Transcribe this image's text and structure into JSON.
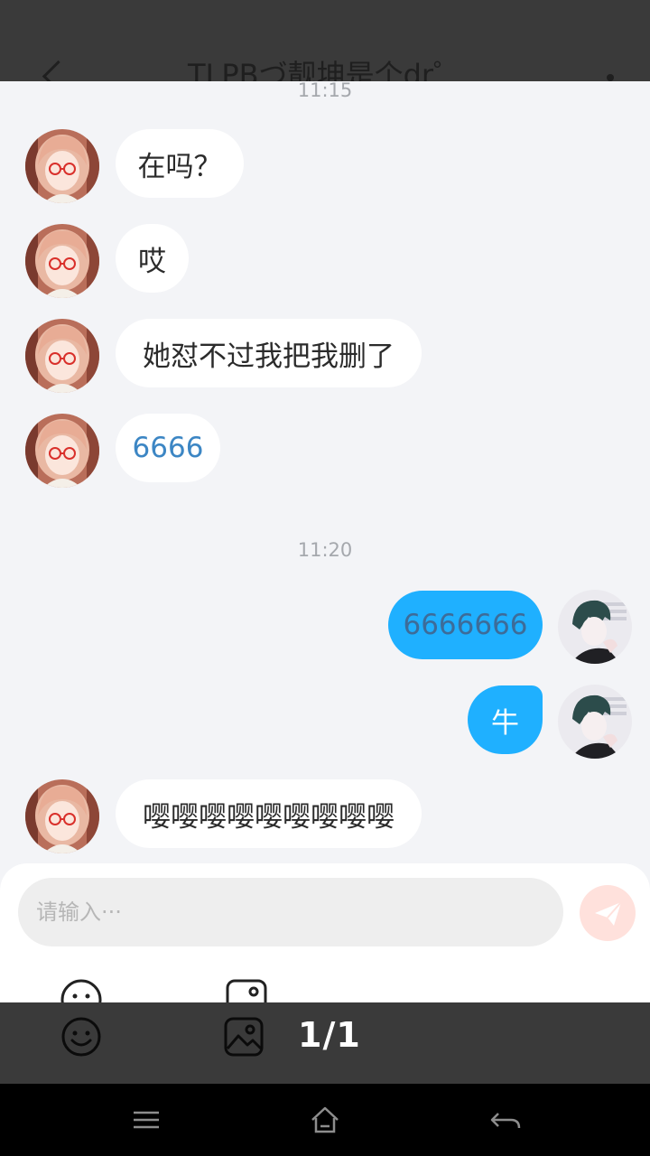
{
  "header": {
    "title": "TLPBづ靓坤是个dr゜",
    "back_icon": "chevron-left-icon",
    "more_icon": "more-dots-icon"
  },
  "chat": {
    "time_1": "11:15",
    "time_2": "11:20",
    "messages": [
      {
        "from": "contact",
        "text": "在吗？"
      },
      {
        "from": "contact",
        "text": "哎"
      },
      {
        "from": "contact",
        "text": "她怼不过我把我删了"
      },
      {
        "from": "contact",
        "text": "6666"
      },
      {
        "from": "me",
        "text": "6666666"
      },
      {
        "from": "me",
        "text": "牛"
      },
      {
        "from": "contact",
        "text": "嘤嘤嘤嘤嘤嘤嘤嘤嘤"
      }
    ]
  },
  "composer": {
    "placeholder": "请输入···",
    "send_icon": "paper-plane-icon",
    "emoji_icon": "smiley-icon",
    "image_icon": "image-icon"
  },
  "viewer": {
    "page_indicator": "1/1"
  },
  "navbar": {
    "menu_icon": "menu-icon",
    "home_icon": "home-icon",
    "back_icon": "back-arrow-icon"
  },
  "colors": {
    "chat_background": "#f3f4f7",
    "outgoing_bubble": "#1fb0ff",
    "incoming_bubble": "#ffffff",
    "send_button": "#ffe1dc"
  }
}
